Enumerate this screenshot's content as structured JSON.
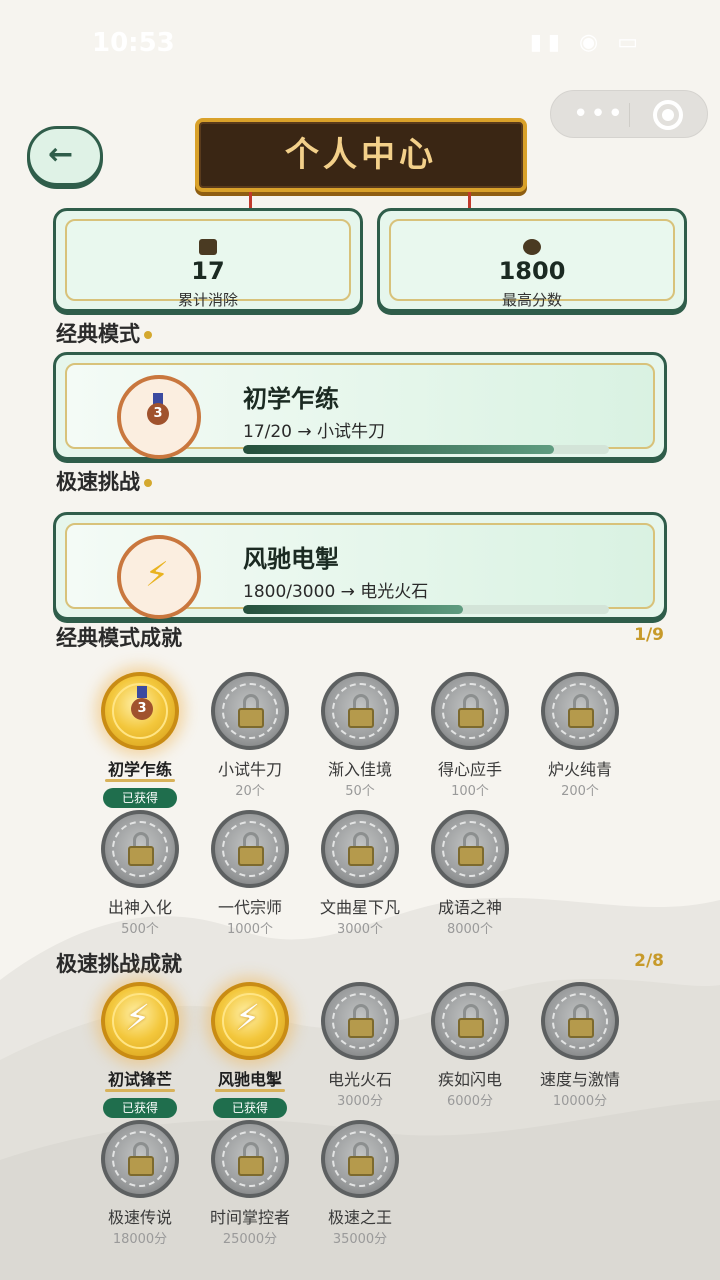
{
  "status_bar": {
    "time": "10:53",
    "icons": "▮▮ ◉ ▭"
  },
  "capsule": {
    "more": "•••"
  },
  "nav": {
    "back_glyph": "←",
    "title": "个人中心"
  },
  "stats": [
    {
      "value": "17",
      "label": "累计消除"
    },
    {
      "value": "1800",
      "label": "最高分数"
    }
  ],
  "modes": {
    "classic": {
      "section_title": "经典模式",
      "name": "初学乍练",
      "progress_text": "17/20 → 小试牛刀",
      "progress": 0.85,
      "medal_number": "3"
    },
    "speed": {
      "section_title": "极速挑战",
      "name": "风驰电掣",
      "progress_text": "1800/3000 → 电光火石",
      "progress": 0.6,
      "bolt": "⚡"
    }
  },
  "classic_achievements": {
    "title": "经典模式成就",
    "count": "1/9",
    "items": [
      {
        "name": "初学乍练",
        "status": "已获得",
        "earned": true,
        "medal": "3"
      },
      {
        "name": "小试牛刀",
        "req": "20个",
        "earned": false
      },
      {
        "name": "渐入佳境",
        "req": "50个",
        "earned": false
      },
      {
        "name": "得心应手",
        "req": "100个",
        "earned": false
      },
      {
        "name": "炉火纯青",
        "req": "200个",
        "earned": false
      },
      {
        "name": "出神入化",
        "req": "500个",
        "earned": false
      },
      {
        "name": "一代宗师",
        "req": "1000个",
        "earned": false
      },
      {
        "name": "文曲星下凡",
        "req": "3000个",
        "earned": false
      },
      {
        "name": "成语之神",
        "req": "8000个",
        "earned": false
      }
    ]
  },
  "speed_achievements": {
    "title": "极速挑战成就",
    "count": "2/8",
    "items": [
      {
        "name": "初试锋芒",
        "status": "已获得",
        "earned": true,
        "bolt": "⚡"
      },
      {
        "name": "风驰电掣",
        "status": "已获得",
        "earned": true,
        "bolt": "⚡"
      },
      {
        "name": "电光火石",
        "req": "3000分",
        "earned": false
      },
      {
        "name": "疾如闪电",
        "req": "6000分",
        "earned": false
      },
      {
        "name": "速度与激情",
        "req": "10000分",
        "earned": false
      },
      {
        "name": "极速传说",
        "req": "18000分",
        "earned": false
      },
      {
        "name": "时间掌控者",
        "req": "25000分",
        "earned": false
      },
      {
        "name": "极速之王",
        "req": "35000分",
        "earned": false
      }
    ]
  },
  "colors": {
    "accent_green": "#2f5d4a",
    "gold": "#d4a82e",
    "badge_green": "#1f6e4d",
    "board": "#3a2614"
  }
}
